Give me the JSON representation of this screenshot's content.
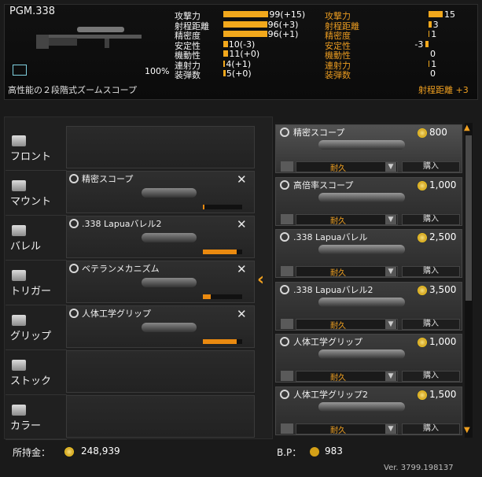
{
  "weapon": {
    "name": "PGM.338",
    "completion": "100%",
    "scope_desc": "高性能の２段階式ズームスコープ",
    "bonus_text": "射程距離 +3"
  },
  "stats_left": [
    {
      "label": "攻撃力",
      "value": "99(+15)",
      "fill": 0.99
    },
    {
      "label": "射程距離",
      "value": "96(+3)",
      "fill": 0.96
    },
    {
      "label": "精密度",
      "value": "96(+1)",
      "fill": 0.96
    },
    {
      "label": "安定性",
      "value": "10(-3)",
      "fill": 0.1
    },
    {
      "label": "機動性",
      "value": "11(+0)",
      "fill": 0.11
    },
    {
      "label": "連射力",
      "value": "4(+1)",
      "fill": 0.04
    },
    {
      "label": "装弾数",
      "value": "5(+0)",
      "fill": 0.05
    }
  ],
  "stats_right": [
    {
      "label": "攻撃力",
      "value": "15",
      "fill": 0.15
    },
    {
      "label": "射程距離",
      "value": "3",
      "fill": 0.03
    },
    {
      "label": "精密度",
      "value": "1",
      "fill": 0.01
    },
    {
      "label": "安定性",
      "value": "-3",
      "fill": -0.03
    },
    {
      "label": "機動性",
      "value": "0",
      "fill": 0
    },
    {
      "label": "連射力",
      "value": "1",
      "fill": 0.01
    },
    {
      "label": "装弾数",
      "value": "0",
      "fill": 0
    }
  ],
  "categories": [
    {
      "label": "フロント",
      "icon": "front-icon"
    },
    {
      "label": "マウント",
      "icon": "mount-icon"
    },
    {
      "label": "バレル",
      "icon": "barrel-icon"
    },
    {
      "label": "トリガー",
      "icon": "trigger-icon"
    },
    {
      "label": "グリップ",
      "icon": "grip-icon"
    },
    {
      "label": "ストック",
      "icon": "stock-icon"
    },
    {
      "label": "カラー",
      "icon": "color-icon"
    }
  ],
  "equipped": [
    {
      "name": "",
      "durability": null
    },
    {
      "name": "精密スコープ",
      "durability": 0.03
    },
    {
      "name": ".338 Lapuaバレル2",
      "durability": 0.85
    },
    {
      "name": "ベテランメカニズム",
      "durability": 0.2
    },
    {
      "name": "人体工学グリップ",
      "durability": 0.85
    },
    {
      "name": "",
      "durability": null
    },
    {
      "name": "",
      "durability": null
    }
  ],
  "shop": [
    {
      "name": "精密スコープ",
      "price": "800",
      "dur": "耐久",
      "buy": "購入"
    },
    {
      "name": "高倍率スコープ",
      "price": "1,000",
      "dur": "耐久",
      "buy": "購入"
    },
    {
      "name": ".338 Lapuaバレル",
      "price": "2,500",
      "dur": "耐久",
      "buy": "購入"
    },
    {
      "name": ".338 Lapuaバレル2",
      "price": "3,500",
      "dur": "耐久",
      "buy": "購入"
    },
    {
      "name": "人体工学グリップ",
      "price": "1,000",
      "dur": "耐久",
      "buy": "購入"
    },
    {
      "name": "人体工学グリップ2",
      "price": "1,500",
      "dur": "耐久",
      "buy": "購入"
    }
  ],
  "footer": {
    "funds_label": "所持金：",
    "funds_value": "248,939",
    "bp_label": "B.P：",
    "bp_value": "983",
    "version": "Ver. 3799.198137"
  }
}
